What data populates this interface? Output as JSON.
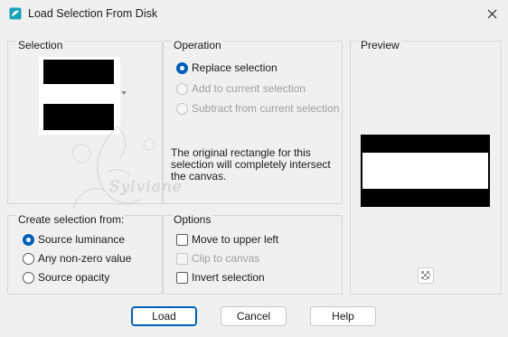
{
  "window": {
    "title": "Load Selection From Disk",
    "close_icon": "close-icon",
    "app_icon": "paintshop-icon"
  },
  "selection_group": {
    "label": "Selection"
  },
  "operation_group": {
    "label": "Operation",
    "options": [
      {
        "label": "Replace selection",
        "selected": true,
        "enabled": true
      },
      {
        "label": "Add to current selection",
        "selected": false,
        "enabled": false
      },
      {
        "label": "Subtract from current selection",
        "selected": false,
        "enabled": false
      }
    ],
    "info": "The original rectangle for this selection will completely intersect the canvas."
  },
  "preview_group": {
    "label": "Preview",
    "checker_icon": "transparency-checker-icon"
  },
  "create_group": {
    "label": "Create selection from:",
    "options": [
      {
        "label": "Source luminance",
        "selected": true
      },
      {
        "label": "Any non-zero value",
        "selected": false
      },
      {
        "label": "Source opacity",
        "selected": false
      }
    ]
  },
  "options_group": {
    "label": "Options",
    "items": [
      {
        "label": "Move to upper left",
        "checked": false,
        "enabled": true
      },
      {
        "label": "Clip to canvas",
        "checked": false,
        "enabled": false
      },
      {
        "label": "Invert selection",
        "checked": false,
        "enabled": true
      }
    ]
  },
  "buttons": {
    "load": "Load",
    "cancel": "Cancel",
    "help": "Help"
  },
  "watermark": {
    "text": "Sylviane"
  },
  "colors": {
    "accent": "#005fb8",
    "background": "#f0f0f0"
  }
}
